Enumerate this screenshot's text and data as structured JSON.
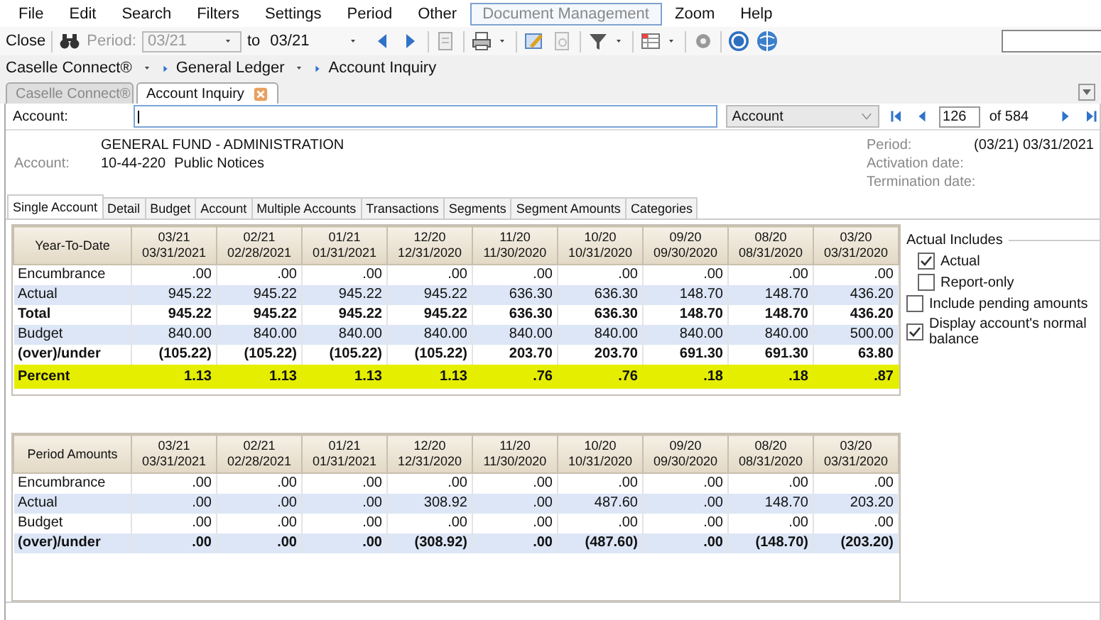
{
  "menu": [
    {
      "label": "File",
      "selected": false
    },
    {
      "label": "Edit",
      "selected": false
    },
    {
      "label": "Search",
      "selected": false
    },
    {
      "label": "Filters",
      "selected": false
    },
    {
      "label": "Settings",
      "selected": false
    },
    {
      "label": "Period",
      "selected": false
    },
    {
      "label": "Other",
      "selected": false
    },
    {
      "label": "Document Management",
      "selected": true
    },
    {
      "label": "Zoom",
      "selected": false
    },
    {
      "label": "Help",
      "selected": false
    }
  ],
  "toolbar": {
    "close": "Close",
    "period_label": "Period:",
    "period_from": "03/21",
    "to_label": "to",
    "period_to": "03/21"
  },
  "breadcrumb": [
    "Caselle Connect®",
    "General Ledger",
    "Account Inquiry"
  ],
  "document_tabs": [
    {
      "label": "Caselle Connect®",
      "selected": false,
      "closable": false
    },
    {
      "label": "Account Inquiry",
      "selected": true,
      "closable": true
    }
  ],
  "account_bar": {
    "label": "Account:",
    "lookup": "Account",
    "record": "126",
    "record_count": "of 584"
  },
  "account_info": {
    "fund": "GENERAL FUND - ADMINISTRATION",
    "label": "Account:",
    "number": "10-44-220",
    "description": "Public Notices",
    "period_label": "Period:",
    "period_value": "(03/21)  03/31/2021",
    "activation_label": "Activation date:",
    "termination_label": "Termination date:"
  },
  "tabs": [
    {
      "label": "Single Account",
      "selected": true
    },
    {
      "label": "Detail",
      "selected": false
    },
    {
      "label": "Budget",
      "selected": false
    },
    {
      "label": "Account",
      "selected": false
    },
    {
      "label": "Multiple Accounts",
      "selected": false
    },
    {
      "label": "Transactions",
      "selected": false
    },
    {
      "label": "Segments",
      "selected": false
    },
    {
      "label": "Segment Amounts",
      "selected": false
    },
    {
      "label": "Categories",
      "selected": false
    }
  ],
  "tables": [
    {
      "title": "Year-To-Date",
      "columns": [
        {
          "period": "03/21",
          "date": "03/31/2021"
        },
        {
          "period": "02/21",
          "date": "02/28/2021"
        },
        {
          "period": "01/21",
          "date": "01/31/2021"
        },
        {
          "period": "12/20",
          "date": "12/31/2020"
        },
        {
          "period": "11/20",
          "date": "11/30/2020"
        },
        {
          "period": "10/20",
          "date": "10/31/2020"
        },
        {
          "period": "09/20",
          "date": "09/30/2020"
        },
        {
          "period": "08/20",
          "date": "08/31/2020"
        },
        {
          "period": "03/20",
          "date": "03/31/2020"
        }
      ],
      "rows": [
        {
          "label": "Encumbrance",
          "bold": false,
          "highlighted": false,
          "values": [
            ".00",
            ".00",
            ".00",
            ".00",
            ".00",
            ".00",
            ".00",
            ".00",
            ".00"
          ]
        },
        {
          "label": "Actual",
          "bold": false,
          "highlighted": false,
          "values": [
            "945.22",
            "945.22",
            "945.22",
            "945.22",
            "636.30",
            "636.30",
            "148.70",
            "148.70",
            "436.20"
          ]
        },
        {
          "label": "Total",
          "bold": true,
          "highlighted": false,
          "values": [
            "945.22",
            "945.22",
            "945.22",
            "945.22",
            "636.30",
            "636.30",
            "148.70",
            "148.70",
            "436.20"
          ]
        },
        {
          "label": "Budget",
          "bold": false,
          "highlighted": false,
          "values": [
            "840.00",
            "840.00",
            "840.00",
            "840.00",
            "840.00",
            "840.00",
            "840.00",
            "840.00",
            "500.00"
          ]
        },
        {
          "label": "(over)/under",
          "bold": true,
          "highlighted": false,
          "values": [
            "(105.22)",
            "(105.22)",
            "(105.22)",
            "(105.22)",
            "203.70",
            "203.70",
            "691.30",
            "691.30",
            "63.80"
          ]
        },
        {
          "label": "Percent",
          "bold": true,
          "highlighted": true,
          "values": [
            "1.13",
            "1.13",
            "1.13",
            "1.13",
            ".76",
            ".76",
            ".18",
            ".18",
            ".87"
          ]
        }
      ]
    },
    {
      "title": "Period Amounts",
      "columns": [
        {
          "period": "03/21",
          "date": "03/31/2021"
        },
        {
          "period": "02/21",
          "date": "02/28/2021"
        },
        {
          "period": "01/21",
          "date": "01/31/2021"
        },
        {
          "period": "12/20",
          "date": "12/31/2020"
        },
        {
          "period": "11/20",
          "date": "11/30/2020"
        },
        {
          "period": "10/20",
          "date": "10/31/2020"
        },
        {
          "period": "09/20",
          "date": "09/30/2020"
        },
        {
          "period": "08/20",
          "date": "08/31/2020"
        },
        {
          "period": "03/20",
          "date": "03/31/2020"
        }
      ],
      "rows": [
        {
          "label": "Encumbrance",
          "bold": false,
          "highlighted": false,
          "values": [
            ".00",
            ".00",
            ".00",
            ".00",
            ".00",
            ".00",
            ".00",
            ".00",
            ".00"
          ]
        },
        {
          "label": "Actual",
          "bold": false,
          "highlighted": false,
          "values": [
            ".00",
            ".00",
            ".00",
            "308.92",
            ".00",
            "487.60",
            ".00",
            "148.70",
            "203.20"
          ]
        },
        {
          "label": "Budget",
          "bold": false,
          "highlighted": false,
          "values": [
            ".00",
            ".00",
            ".00",
            ".00",
            ".00",
            ".00",
            ".00",
            ".00",
            ".00"
          ]
        },
        {
          "label": "(over)/under",
          "bold": true,
          "highlighted": false,
          "values": [
            ".00",
            ".00",
            ".00",
            "(308.92)",
            ".00",
            "(487.60)",
            ".00",
            "(148.70)",
            "(203.20)"
          ]
        }
      ]
    }
  ],
  "options": {
    "group_title": "Actual Includes",
    "group_options": [
      {
        "label": "Actual",
        "checked": true
      },
      {
        "label": "Report-only",
        "checked": false
      }
    ],
    "other_options": [
      {
        "label": "Include pending amounts",
        "checked": false
      },
      {
        "label": "Display account's normal balance",
        "checked": true
      }
    ]
  }
}
